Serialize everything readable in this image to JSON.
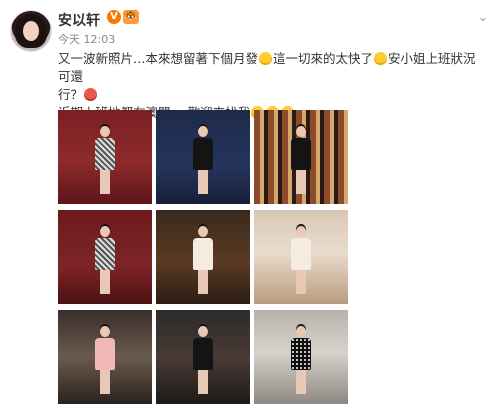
{
  "post": {
    "author": "安以轩",
    "verified_mark": "V",
    "level_mark": "🐯",
    "timestamp": "今天 12:03",
    "line1_a": "又一波新照片…本來想留著下個月發",
    "line1_b": "這一切來的太快了",
    "line1_c": "安小姐上班狀況可還",
    "line2": "行？",
    "line3": "近期上班地都在澳門",
    "line3_tag": "мо",
    "line3_b": "歡迎來找我",
    "more_chevron": "⌄"
  },
  "icons": {
    "avatar": "user-avatar",
    "verified": "verified-badge-icon",
    "level": "tiger-level-icon",
    "more": "chevron-down-icon",
    "emoji_sweat": "sweat-emoji-icon",
    "emoji_laugh": "laugh-cry-emoji-icon",
    "emoji_spicy": "chili-emoji-icon",
    "emoji_grin": "grin-emoji-icon"
  },
  "photos": [
    {
      "outfit": "tweed",
      "scene": "red velvet wall"
    },
    {
      "outfit": "black",
      "scene": "blue curtain"
    },
    {
      "outfit": "black",
      "scene": "gold striped bar"
    },
    {
      "outfit": "tweed",
      "scene": "red velvet chair"
    },
    {
      "outfit": "cream",
      "scene": "bar with costumed waiter"
    },
    {
      "outfit": "cream",
      "scene": "afternoon tea table"
    },
    {
      "outfit": "pink",
      "scene": "doorway"
    },
    {
      "outfit": "black",
      "scene": "lounge"
    },
    {
      "outfit": "dots",
      "scene": "street"
    }
  ],
  "colors": {
    "username": "#333333",
    "timestamp": "#888888",
    "verified": "#f57a00",
    "level": "#ff9a3c"
  }
}
